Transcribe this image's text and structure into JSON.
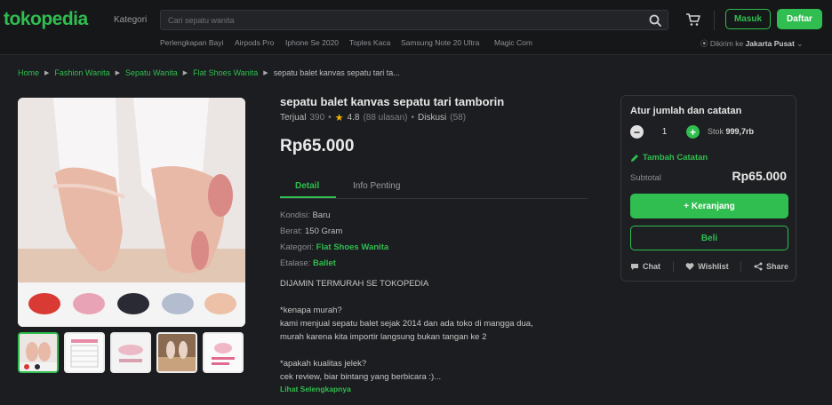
{
  "header": {
    "logo": "tokopedia",
    "kategori": "Kategori",
    "search_placeholder": "Cari sepatu wanita",
    "masuk": "Masuk",
    "daftar": "Daftar",
    "suggestions": [
      "Perlengkapan Bayi",
      "Airpods Pro",
      "Iphone Se 2020",
      "Toples Kaca",
      "Samsung Note 20 Ultra",
      "Magic Com"
    ],
    "location_prefix": "Dikirim ke",
    "location": "Jakarta Pusat",
    "accent": "#2fbe4f"
  },
  "breadcrumb": [
    "Home",
    "Fashion Wanita",
    "Sepatu Wanita",
    "Flat Shoes Wanita",
    "sepatu balet kanvas sepatu tari ta..."
  ],
  "product": {
    "title": "sepatu balet kanvas sepatu tari tamborin",
    "terjual_label": "Terjual",
    "terjual": "390",
    "rating": "4.8",
    "ulasan": "(88 ulasan)",
    "diskusi_label": "Diskusi",
    "diskusi": "(58)",
    "price": "Rp65.000"
  },
  "tabs": [
    "Detail",
    "Info Penting"
  ],
  "details": {
    "kondisi_label": "Kondisi:",
    "kondisi": "Baru",
    "berat_label": "Berat:",
    "berat": "150 Gram",
    "kategori_label": "Kategori:",
    "kategori": "Flat Shoes Wanita",
    "etalase_label": "Etalase:",
    "etalase": "Ballet"
  },
  "description": [
    "DIJAMIN TERMURAH SE TOKOPEDIA",
    "*kenapa murah?",
    "kami menjual sepatu balet sejak 2014 dan ada toko di mangga dua,",
    "murah karena kita importir langsung bukan tangan ke 2",
    "*apakah kualitas jelek?",
    "cek review, biar bintang yang berbicara :)..."
  ],
  "more_link": "Lihat Selengkapnya",
  "panel": {
    "title": "Atur jumlah dan catatan",
    "qty": "1",
    "stok_label": "Stok",
    "stok": "999,7rb",
    "catatan": "Tambah Catatan",
    "subtotal_label": "Subtotal",
    "subtotal": "Rp65.000",
    "cart_button": "+ Keranjang",
    "buy_button": "Beli",
    "chat": "Chat",
    "wishlist": "Wishlist",
    "share": "Share"
  }
}
